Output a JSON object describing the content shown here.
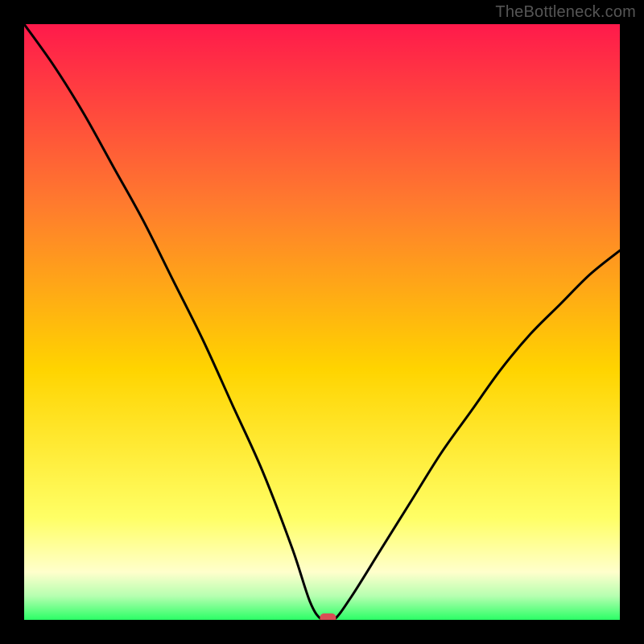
{
  "watermark": "TheBottleneck.com",
  "colors": {
    "gradient_top": "#ff1a4b",
    "gradient_mid1": "#ff7a2e",
    "gradient_mid2": "#ffd400",
    "gradient_low": "#ffff66",
    "gradient_pale": "#ffffcc",
    "gradient_green_pale": "#b6ffb0",
    "gradient_green": "#2bff66",
    "frame_black": "#000000",
    "curve": "#000000",
    "marker": "#d94f55"
  },
  "chart_data": {
    "type": "line",
    "title": "",
    "xlabel": "",
    "ylabel": "",
    "xlim": [
      0,
      100
    ],
    "ylim": [
      0,
      100
    ],
    "series": [
      {
        "name": "bottleneck-curve",
        "x": [
          0,
          5,
          10,
          15,
          20,
          25,
          30,
          35,
          40,
          45,
          48,
          50,
          52,
          55,
          60,
          65,
          70,
          75,
          80,
          85,
          90,
          95,
          100
        ],
        "y": [
          100,
          93,
          85,
          76,
          67,
          57,
          47,
          36,
          25,
          12,
          3,
          0,
          0,
          4,
          12,
          20,
          28,
          35,
          42,
          48,
          53,
          58,
          62
        ]
      }
    ],
    "marker": {
      "x": 51,
      "y": 0,
      "shape": "rounded-rect"
    },
    "notes": "Background is a vertical heat gradient (red→orange→yellow→pale→green) framed by black. A black curve descends steeply from top-left, reaches ~0 near x≈50, then rises toward the right. A small red rounded marker sits at the curve minimum on the bottom edge."
  }
}
